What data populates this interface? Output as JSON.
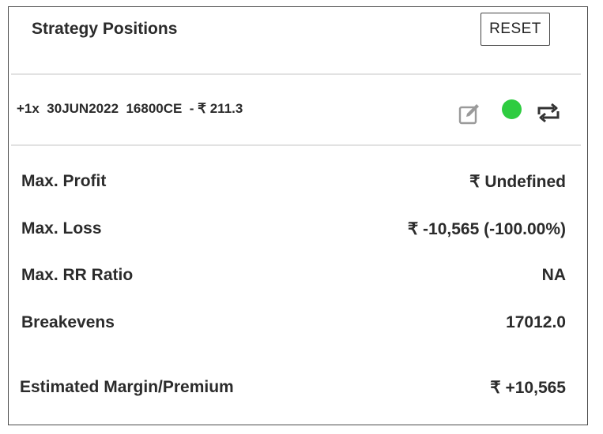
{
  "header": {
    "title": "Strategy Positions",
    "reset_label": "RESET"
  },
  "position": {
    "summary": "+1x  30JUN2022  16800CE  - ₹ 211.3",
    "edit_icon": "edit-icon",
    "status_color": "#2ecc40",
    "swap_icon": "repeat-icon"
  },
  "stats": [
    {
      "label": "Max. Profit",
      "value": "₹ Undefined"
    },
    {
      "label": "Max. Loss",
      "value": "₹ -10,565 (-100.00%)"
    },
    {
      "label": "Max. RR Ratio",
      "value": "NA"
    },
    {
      "label": "Breakevens",
      "value": "17012.0"
    }
  ],
  "margin": {
    "label": "Estimated Margin/Premium",
    "value": "₹ +10,565"
  }
}
